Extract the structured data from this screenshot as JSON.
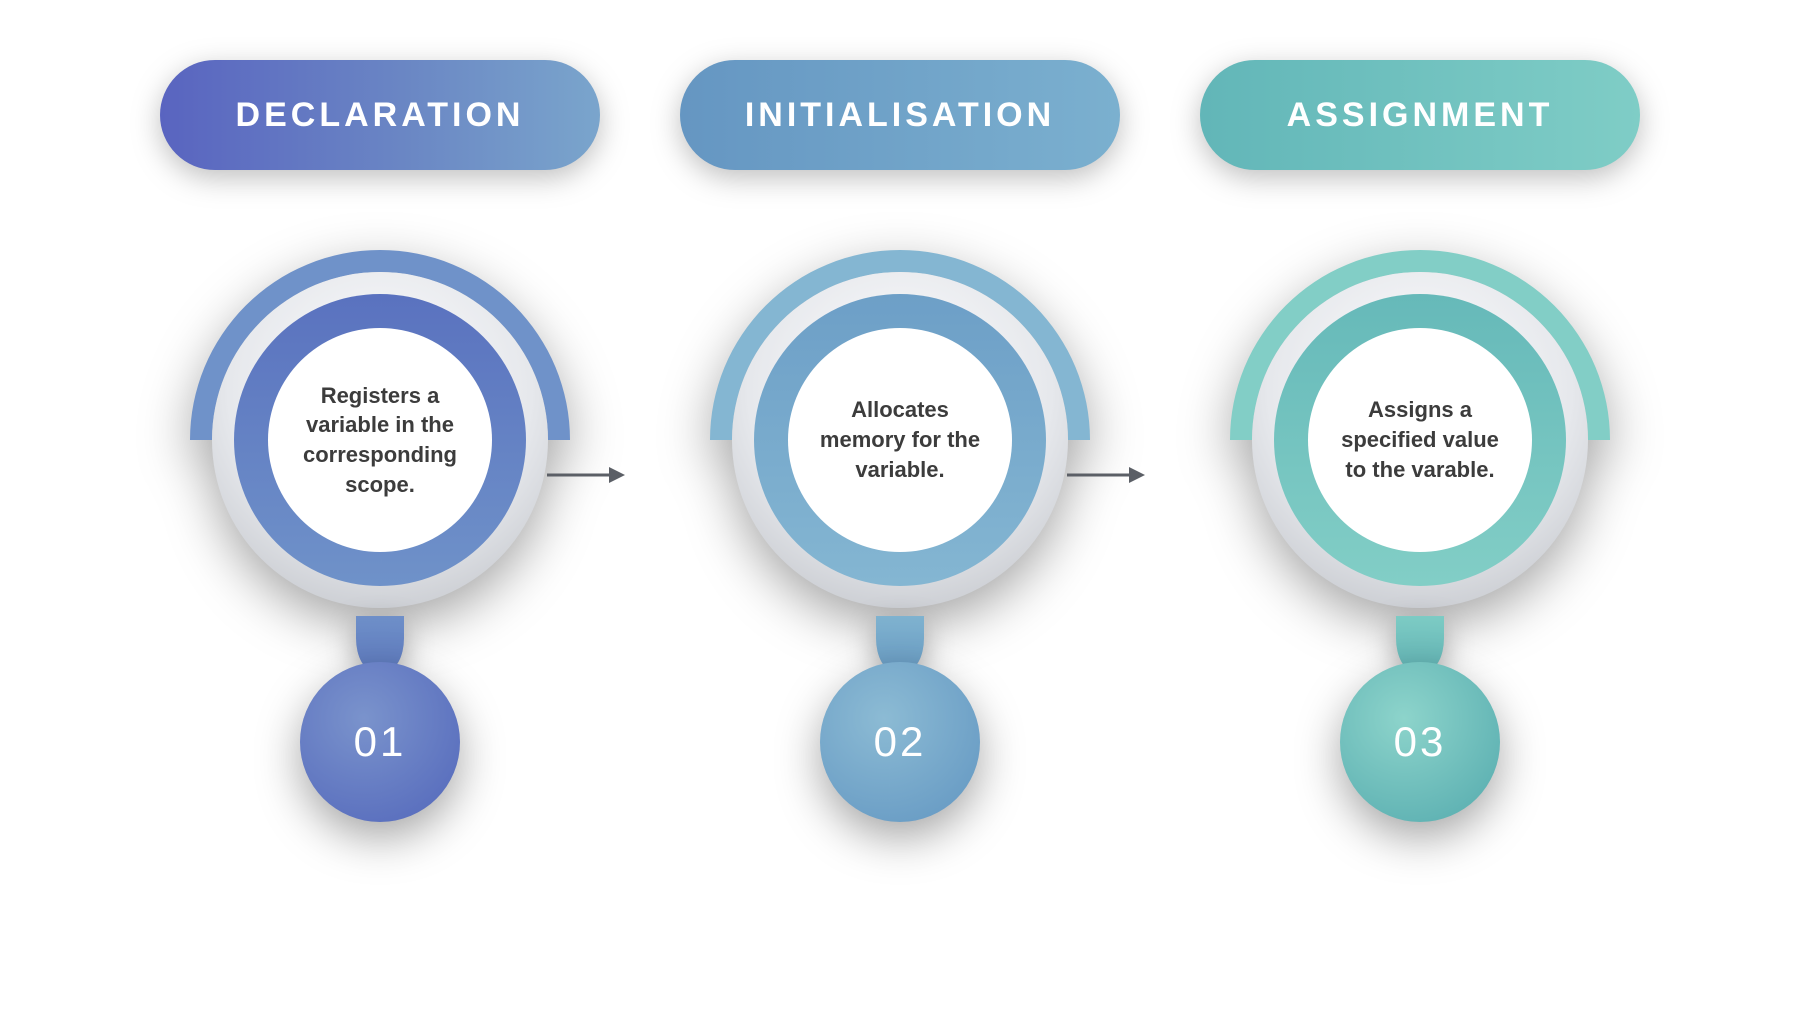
{
  "steps": [
    {
      "number": "01",
      "title": "DECLARATION",
      "description": "Registers a variable in the corresponding scope."
    },
    {
      "number": "02",
      "title": "INITIALISATION",
      "description": "Allocates memory for the variable."
    },
    {
      "number": "03",
      "title": "ASSIGNMENT",
      "description": "Assigns a specified value to the varable."
    }
  ]
}
